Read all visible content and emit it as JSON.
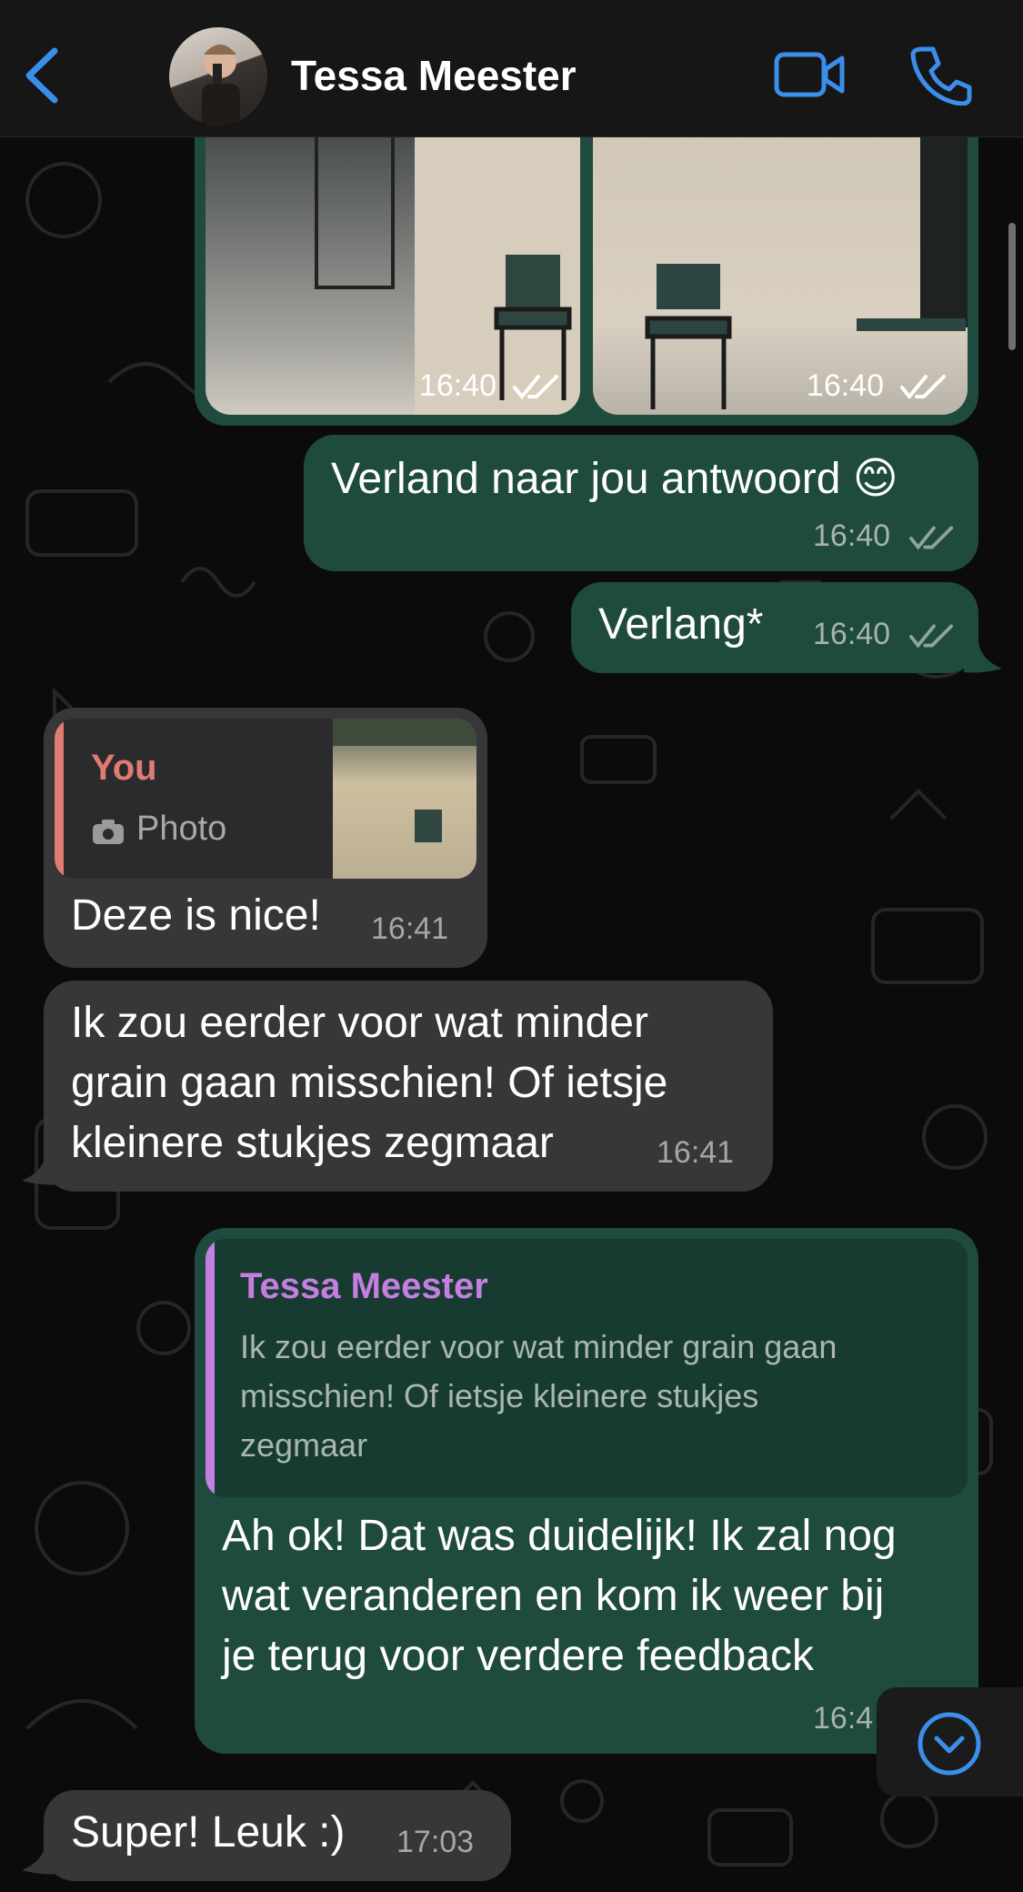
{
  "header": {
    "contact_name": "Tessa Meester"
  },
  "messages": {
    "photo1_time": "16:40",
    "photo2_time": "16:40",
    "m1_text": "Verland naar jou antwoord 😊",
    "m1_time": "16:40",
    "m2_text": "Verlang*",
    "m2_time": "16:40",
    "m3_reply_author": "You",
    "m3_reply_type": "Photo",
    "m3_text": "Deze is nice!",
    "m3_time": "16:41",
    "m4_text": "Ik zou eerder voor wat minder\ngrain gaan misschien! Of ietsje\nkleinere stukjes zegmaar",
    "m4_time": "16:41",
    "m5_reply_author": "Tessa Meester",
    "m5_reply_text": "Ik zou eerder voor wat minder grain gaan\nmisschien! Of ietsje kleinere stukjes\nzegmaar",
    "m5_text": "Ah ok! Dat was duidelijk! Ik zal nog\nwat veranderen en kom ik weer bij\nje terug voor verdere feedback",
    "m5_time": "16:4",
    "m6_text": "Super! Leuk :)",
    "m6_time": "17:03"
  },
  "colors": {
    "accent": "#3b8eea",
    "outgoing_bubble": "#1f4a3e",
    "incoming_bubble": "#373638",
    "reply_you": "#e07a73",
    "reply_tessa": "#c47fe0"
  }
}
